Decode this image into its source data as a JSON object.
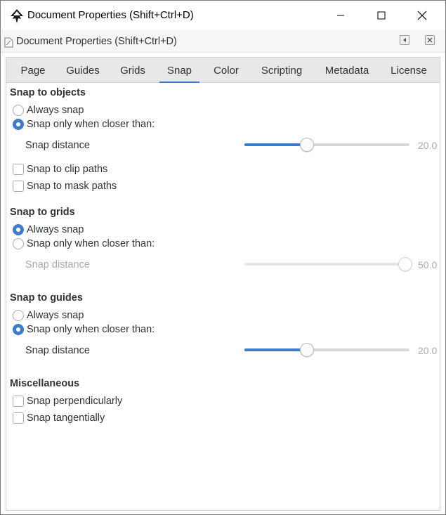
{
  "window": {
    "title": "Document Properties (Shift+Ctrl+D)",
    "icon": "inkscape-logo-icon"
  },
  "panel": {
    "title": "Document Properties (Shift+Ctrl+D)"
  },
  "tabs": [
    {
      "label": "Page",
      "active": false
    },
    {
      "label": "Guides",
      "active": false
    },
    {
      "label": "Grids",
      "active": false
    },
    {
      "label": "Snap",
      "active": true
    },
    {
      "label": "Color",
      "active": false
    },
    {
      "label": "Scripting",
      "active": false
    },
    {
      "label": "Metadata",
      "active": false
    },
    {
      "label": "License",
      "active": false
    }
  ],
  "objects": {
    "heading": "Snap to objects",
    "always": "Always snap",
    "closer": "Snap only when closer than:",
    "selected": "closer",
    "distance_label": "Snap distance",
    "distance_value": "20.0",
    "distance_fraction": 0.38,
    "clip": "Snap to clip paths",
    "mask": "Snap to mask paths",
    "clip_checked": false,
    "mask_checked": false
  },
  "grids": {
    "heading": "Snap to grids",
    "always": "Always snap",
    "closer": "Snap only when closer than:",
    "selected": "always",
    "distance_label": "Snap distance",
    "distance_value": "50.0",
    "distance_fraction": 1.0,
    "disabled": true
  },
  "guides": {
    "heading": "Snap to guides",
    "always": "Always snap",
    "closer": "Snap only when closer than:",
    "selected": "closer",
    "distance_label": "Snap distance",
    "distance_value": "20.0",
    "distance_fraction": 0.38
  },
  "misc": {
    "heading": "Miscellaneous",
    "perpendicular": "Snap perpendicularly",
    "tangential": "Snap tangentially",
    "perpendicular_checked": false,
    "tangential_checked": false
  },
  "colors": {
    "accent": "#3d7dcb",
    "text": "#2e3436",
    "dim_text": "#a9acab"
  }
}
